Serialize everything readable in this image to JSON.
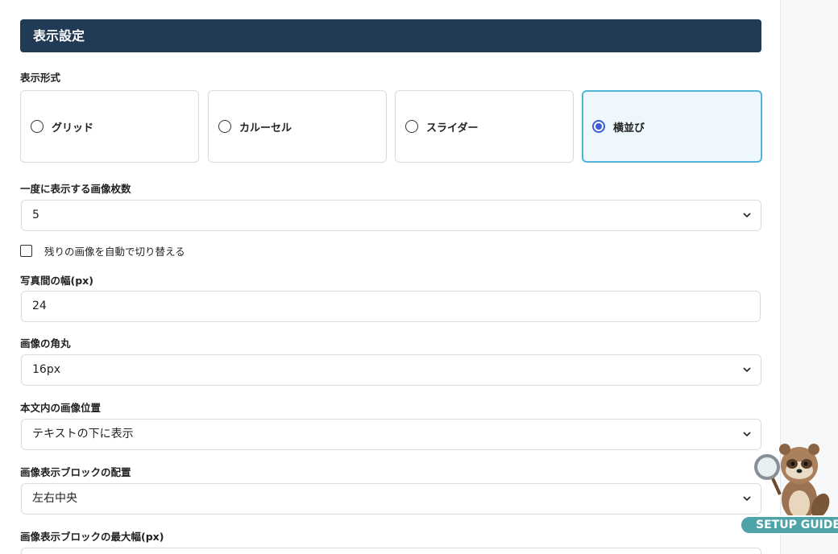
{
  "section": {
    "title": "表示設定"
  },
  "display_format": {
    "label": "表示形式",
    "options": [
      {
        "label": "グリッド",
        "selected": false
      },
      {
        "label": "カルーセル",
        "selected": false
      },
      {
        "label": "スライダー",
        "selected": false
      },
      {
        "label": "横並び",
        "selected": true
      }
    ]
  },
  "images_per_view": {
    "label": "一度に表示する画像枚数",
    "value": "5"
  },
  "auto_switch": {
    "label": "残りの画像を自動で切り替える",
    "checked": false
  },
  "photo_gap": {
    "label": "写真間の幅(px)",
    "value": "24"
  },
  "image_radius": {
    "label": "画像の角丸",
    "value": "16px"
  },
  "image_position": {
    "label": "本文内の画像位置",
    "value": "テキストの下に表示"
  },
  "block_align": {
    "label": "画像表示ブロックの配置",
    "value": "左右中央"
  },
  "block_max_width": {
    "label": "画像表示ブロックの最大幅(px)"
  },
  "setup_guide": {
    "label": "SETUP GUIDE M"
  },
  "colors": {
    "header_bg": "#213a56",
    "selected_border": "#4fb6d9",
    "radio_accent": "#3b5bdb",
    "badge_bg": "#4da3a8"
  }
}
